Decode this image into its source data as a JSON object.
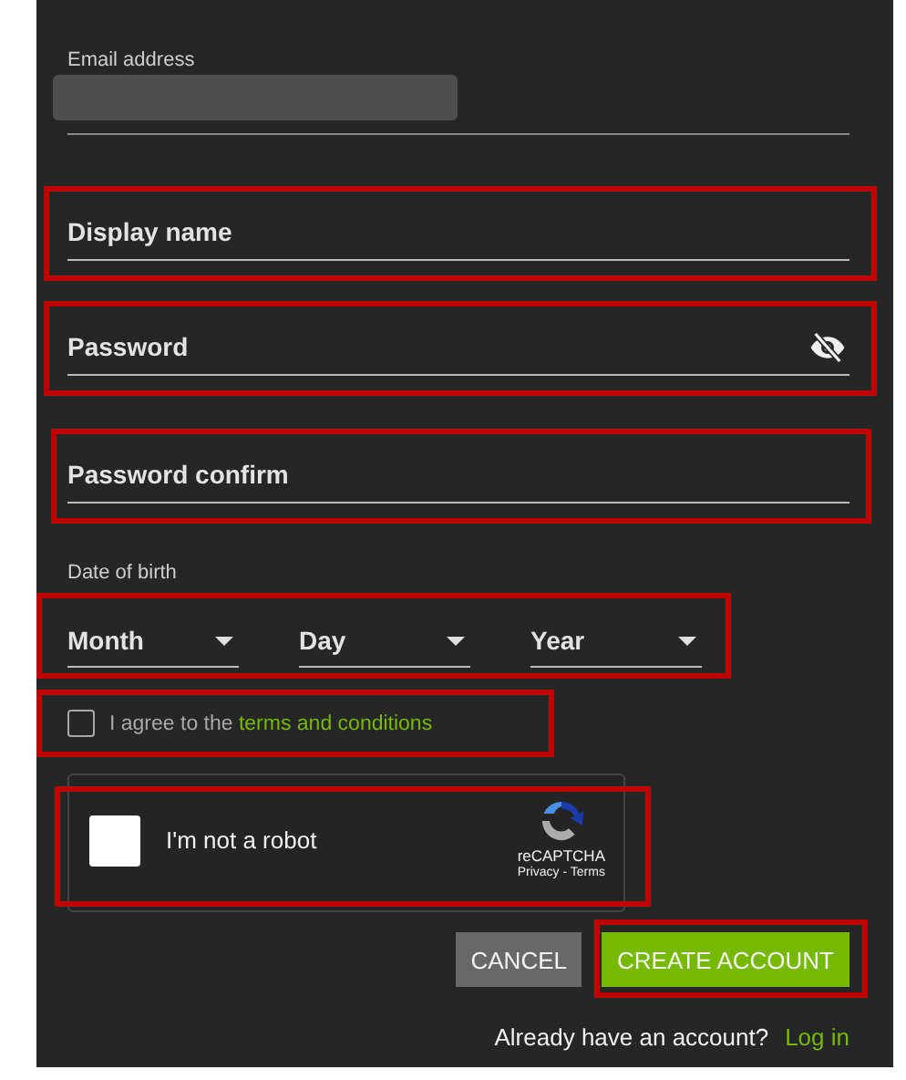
{
  "email": {
    "label": "Email address",
    "redacted": true
  },
  "fields": [
    {
      "kind": "text",
      "placeholder": "Display name",
      "highlighted": true
    },
    {
      "kind": "password",
      "placeholder": "Password",
      "highlighted": true
    },
    {
      "kind": "text",
      "placeholder": "Password confirm",
      "highlighted": true
    }
  ],
  "date_of_birth": {
    "label": "Date of birth",
    "highlighted": true,
    "selects": [
      {
        "label": "Month"
      },
      {
        "label": "Day"
      },
      {
        "label": "Year"
      }
    ]
  },
  "terms": {
    "text": "I agree to the",
    "link": "terms and conditions",
    "checked": false,
    "highlighted": true
  },
  "recaptcha": {
    "label": "I'm not a robot",
    "checked": false,
    "brand": "reCAPTCHA",
    "links": "Privacy - Terms",
    "highlighted": true
  },
  "buttons": [
    {
      "label": "CANCEL",
      "kind": "secondary",
      "highlighted": false
    },
    {
      "label": "CREATE ACCOUNT",
      "kind": "primary",
      "highlighted": true
    }
  ],
  "login": {
    "text": "Already have an account?",
    "link": "Log in"
  }
}
